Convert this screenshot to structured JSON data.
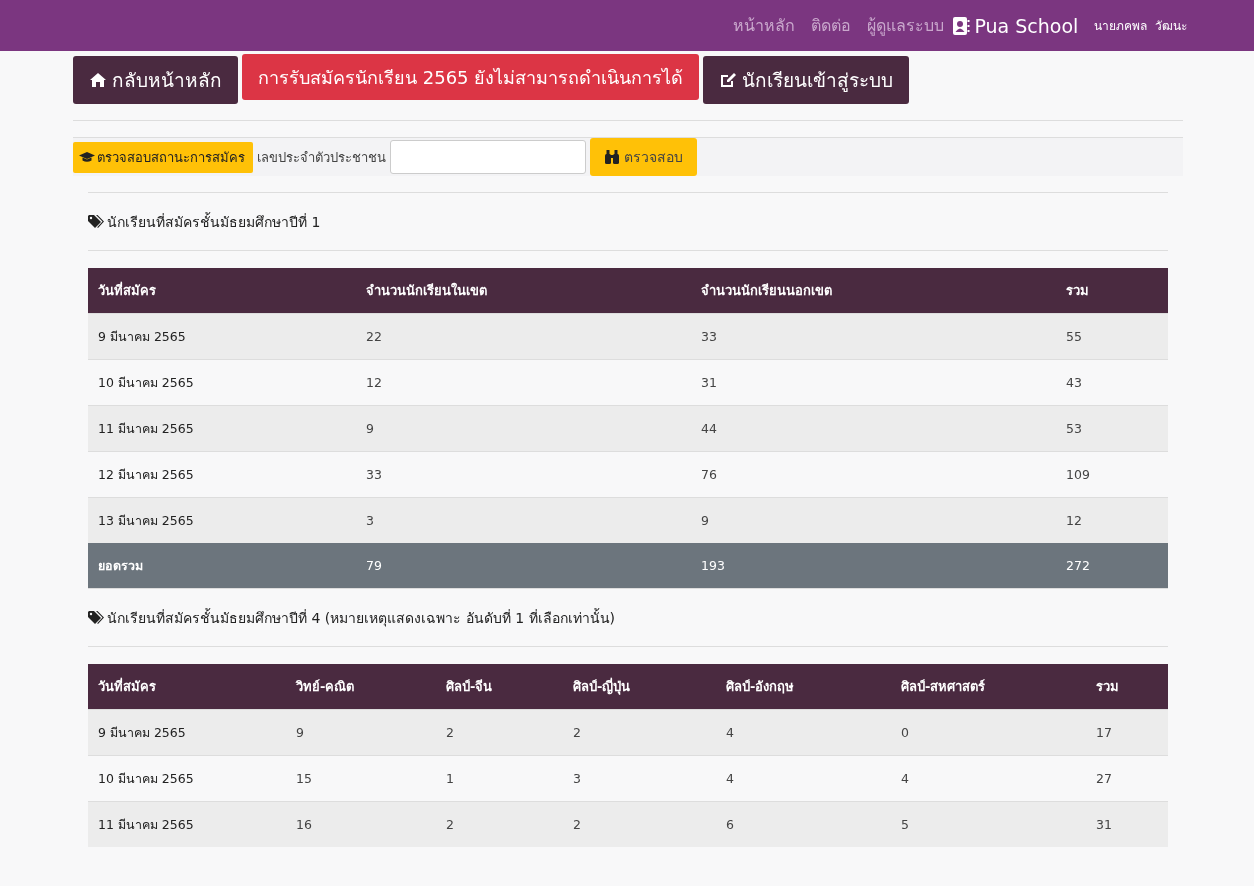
{
  "navbar": {
    "links": [
      "หน้าหลัก",
      "ติดต่อ",
      "ผู้ดูแลระบบ"
    ],
    "brand": "Pua School",
    "user": "นายภคพล  วัฒนะ"
  },
  "actions": {
    "home_button": "กลับหน้าหลัก",
    "notice": "การรับสมัครนักเรียน 2565 ยังไม่สามารถดำเนินการได้",
    "login_button": "นักเรียนเข้าสู่ระบบ"
  },
  "status_check": {
    "badge": "ตรวจสอบสถานะการสมัคร",
    "label": "เลขประจำตัวประชาชน",
    "button": "ตรวจสอบ"
  },
  "tables": [
    {
      "title": "นักเรียนที่สมัครชั้นมัธยมศึกษาปีที่ 1",
      "columns": [
        "วันที่สมัคร",
        "จำนวนนักเรียนในเขต",
        "จำนวนนักเรียนนอกเขต",
        "รวม"
      ],
      "rows": [
        {
          "kind": "data",
          "cells": [
            "9 มีนาคม 2565",
            "22",
            "33",
            "55"
          ]
        },
        {
          "kind": "data",
          "cells": [
            "10 มีนาคม 2565",
            "12",
            "31",
            "43"
          ]
        },
        {
          "kind": "data",
          "cells": [
            "11 มีนาคม 2565",
            "9",
            "44",
            "53"
          ]
        },
        {
          "kind": "data",
          "cells": [
            "12 มีนาคม 2565",
            "33",
            "76",
            "109"
          ]
        },
        {
          "kind": "data",
          "cells": [
            "13 มีนาคม 2565",
            "3",
            "9",
            "12"
          ]
        },
        {
          "kind": "total",
          "cells": [
            "ยอดรวม",
            "79",
            "193",
            "272"
          ]
        }
      ]
    },
    {
      "title": "นักเรียนที่สมัครชั้นมัธยมศึกษาปีที่ 4 (หมายเหตุแสดงเฉพาะ อันดับที่ 1 ที่เลือกเท่านั้น)",
      "columns": [
        "วันที่สมัคร",
        "วิทย์-คณิต",
        "ศิลป์-จีน",
        "ศิลป์-ญี่ปุ่น",
        "ศิลป์-อังกฤษ",
        "ศิลป์-สหศาสตร์",
        "รวม"
      ],
      "rows": [
        {
          "kind": "data",
          "cells": [
            "9 มีนาคม 2565",
            "9",
            "2",
            "2",
            "4",
            "0",
            "17"
          ]
        },
        {
          "kind": "data",
          "cells": [
            "10 มีนาคม 2565",
            "15",
            "1",
            "3",
            "4",
            "4",
            "27"
          ]
        },
        {
          "kind": "data",
          "cells": [
            "11 มีนาคม 2565",
            "16",
            "2",
            "2",
            "6",
            "5",
            "31"
          ]
        }
      ]
    }
  ]
}
